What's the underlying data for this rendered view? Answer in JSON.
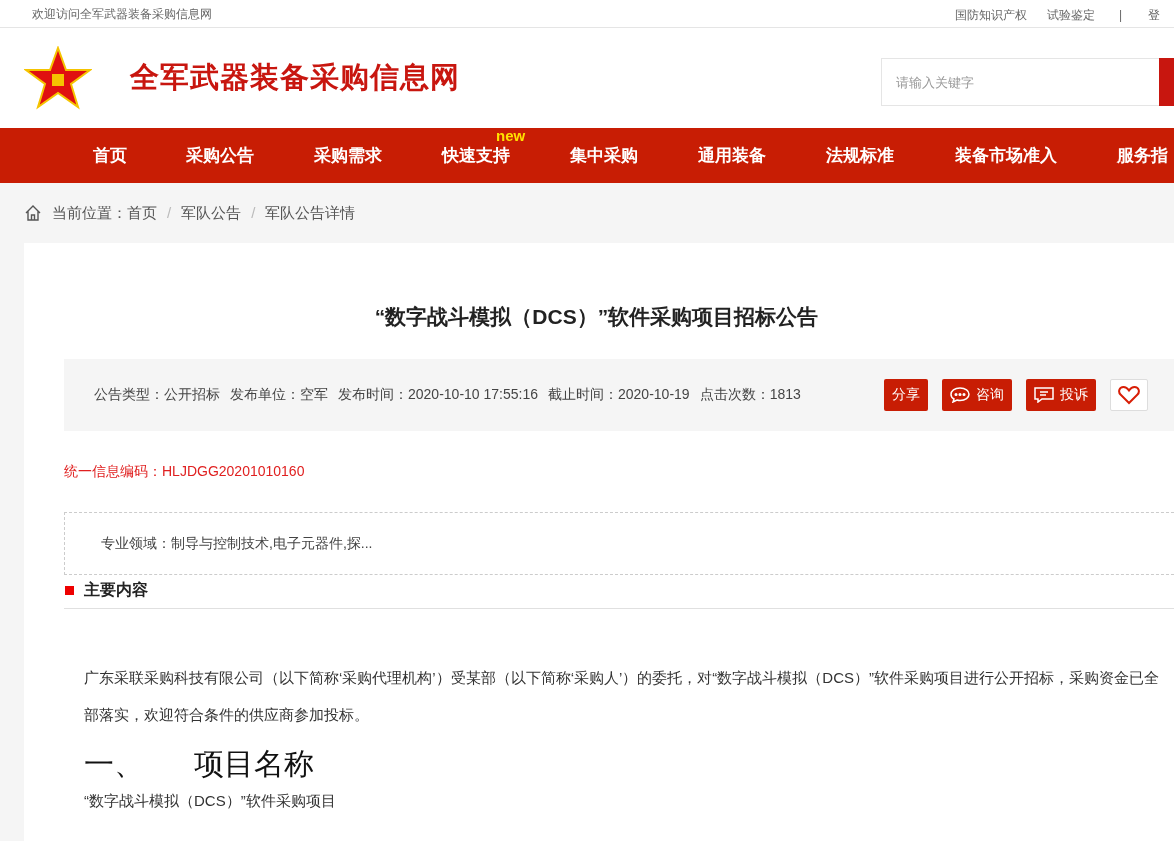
{
  "top_bar": {
    "welcome": "欢迎访问全军武器装备采购信息网",
    "links": [
      "国防知识产权",
      "试验鉴定"
    ],
    "separator": "|",
    "login": "登"
  },
  "header": {
    "site_title": "全军武器装备采购信息网",
    "search": {
      "placeholder": "请输入关键字"
    }
  },
  "nav": [
    {
      "label": "首页"
    },
    {
      "label": "采购公告"
    },
    {
      "label": "采购需求"
    },
    {
      "label": "快速支持",
      "badge": "new"
    },
    {
      "label": "集中采购"
    },
    {
      "label": "通用装备"
    },
    {
      "label": "法规标准"
    },
    {
      "label": "装备市场准入"
    },
    {
      "label": "服务指"
    }
  ],
  "breadcrumb": {
    "label": "当前位置：",
    "items": [
      "首页",
      "军队公告",
      "军队公告详情"
    ],
    "separator": "/"
  },
  "article": {
    "title": "“数字战斗模拟（DCS）”软件采购项目招标公告",
    "meta": [
      "公告类型：公开招标",
      "发布单位：空军",
      "发布时间：2020-10-10 17:55:16",
      "截止时间：2020-10-19",
      "点击次数：1813"
    ],
    "actions": [
      {
        "kind": "text",
        "label": "分享"
      },
      {
        "kind": "chat",
        "label": "咨询"
      },
      {
        "kind": "complain",
        "label": "投诉"
      },
      {
        "kind": "heart"
      }
    ],
    "code": "统一信息编码：HLJDGG20201010160",
    "field": "专业领域：制导与控制技术,电子元器件,探...",
    "section_title": "主要内容",
    "intro": "广东采联采购科技有限公司（以下简称‘采购代理机构’）受某部（以下简称‘采购人’）的委托，对“数字战斗模拟（DCS）”软件采购项目进行公开招标，采购资金已全部落实，欢迎符合条件的供应商参加投标。",
    "heading_number": "一、",
    "heading_text": "项目名称",
    "project_name": "“数字战斗模拟（DCS）”软件采购项目"
  }
}
